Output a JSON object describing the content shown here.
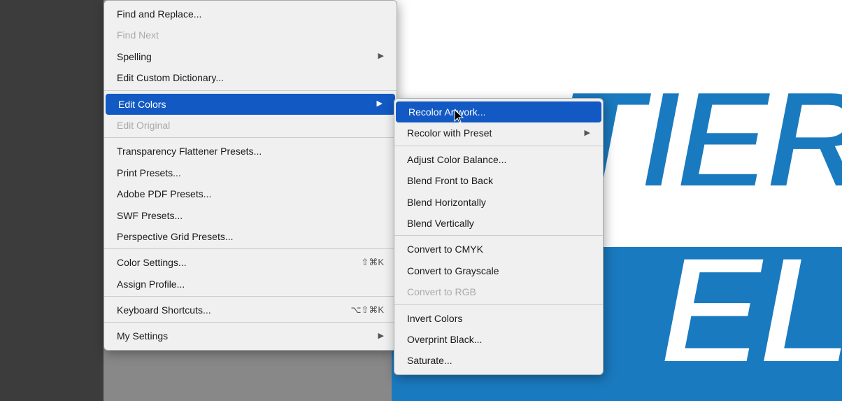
{
  "background": {
    "color": "#888888"
  },
  "canvas": {
    "text_tier": "TIER",
    "text_el": "EL",
    "blue_color": "#1a7abf"
  },
  "primary_menu": {
    "items": [
      {
        "id": "find-replace",
        "label": "Find and Replace...",
        "shortcut": "",
        "arrow": false,
        "disabled": false,
        "active": false,
        "separator_above": false,
        "separator_below": false
      },
      {
        "id": "find-next",
        "label": "Find Next",
        "shortcut": "",
        "arrow": false,
        "disabled": true,
        "active": false,
        "separator_above": false,
        "separator_below": false
      },
      {
        "id": "spelling",
        "label": "Spelling",
        "shortcut": "",
        "arrow": true,
        "disabled": false,
        "active": false,
        "separator_above": false,
        "separator_below": false
      },
      {
        "id": "edit-custom-dictionary",
        "label": "Edit Custom Dictionary...",
        "shortcut": "",
        "arrow": false,
        "disabled": false,
        "active": false,
        "separator_above": false,
        "separator_below": true
      },
      {
        "id": "edit-colors",
        "label": "Edit Colors",
        "shortcut": "",
        "arrow": true,
        "disabled": false,
        "active": true,
        "separator_above": false,
        "separator_below": false
      },
      {
        "id": "edit-original",
        "label": "Edit Original",
        "shortcut": "",
        "arrow": false,
        "disabled": true,
        "active": false,
        "separator_above": false,
        "separator_below": true
      },
      {
        "id": "transparency-flattener",
        "label": "Transparency Flattener Presets...",
        "shortcut": "",
        "arrow": false,
        "disabled": false,
        "active": false,
        "separator_above": false,
        "separator_below": false
      },
      {
        "id": "print-presets",
        "label": "Print Presets...",
        "shortcut": "",
        "arrow": false,
        "disabled": false,
        "active": false,
        "separator_above": false,
        "separator_below": false
      },
      {
        "id": "adobe-pdf-presets",
        "label": "Adobe PDF Presets...",
        "shortcut": "",
        "arrow": false,
        "disabled": false,
        "active": false,
        "separator_above": false,
        "separator_below": false
      },
      {
        "id": "swf-presets",
        "label": "SWF Presets...",
        "shortcut": "",
        "arrow": false,
        "disabled": false,
        "active": false,
        "separator_above": false,
        "separator_below": false
      },
      {
        "id": "perspective-grid-presets",
        "label": "Perspective Grid Presets...",
        "shortcut": "",
        "arrow": false,
        "disabled": false,
        "active": false,
        "separator_above": false,
        "separator_below": true
      },
      {
        "id": "color-settings",
        "label": "Color Settings...",
        "shortcut": "⇧⌘K",
        "arrow": false,
        "disabled": false,
        "active": false,
        "separator_above": false,
        "separator_below": false
      },
      {
        "id": "assign-profile",
        "label": "Assign Profile...",
        "shortcut": "",
        "arrow": false,
        "disabled": false,
        "active": false,
        "separator_above": false,
        "separator_below": true
      },
      {
        "id": "keyboard-shortcuts",
        "label": "Keyboard Shortcuts...",
        "shortcut": "⌥⇧⌘K",
        "arrow": false,
        "disabled": false,
        "active": false,
        "separator_above": false,
        "separator_below": true
      },
      {
        "id": "my-settings",
        "label": "My Settings",
        "shortcut": "",
        "arrow": true,
        "disabled": false,
        "active": false,
        "separator_above": false,
        "separator_below": false
      }
    ]
  },
  "secondary_menu": {
    "items": [
      {
        "id": "recolor-artwork",
        "label": "Recolor Artwork...",
        "shortcut": "",
        "arrow": false,
        "disabled": false,
        "active": true
      },
      {
        "id": "recolor-with-preset",
        "label": "Recolor with Preset",
        "shortcut": "",
        "arrow": true,
        "disabled": false,
        "active": false
      },
      {
        "id": "adjust-color-balance",
        "label": "Adjust Color Balance...",
        "shortcut": "",
        "arrow": false,
        "disabled": false,
        "active": false
      },
      {
        "id": "blend-front-to-back",
        "label": "Blend Front to Back",
        "shortcut": "",
        "arrow": false,
        "disabled": false,
        "active": false
      },
      {
        "id": "blend-horizontally",
        "label": "Blend Horizontally",
        "shortcut": "",
        "arrow": false,
        "disabled": false,
        "active": false
      },
      {
        "id": "blend-vertically",
        "label": "Blend Vertically",
        "shortcut": "",
        "arrow": false,
        "disabled": false,
        "active": false
      },
      {
        "id": "convert-to-cmyk",
        "label": "Convert to CMYK",
        "shortcut": "",
        "arrow": false,
        "disabled": false,
        "active": false
      },
      {
        "id": "convert-to-grayscale",
        "label": "Convert to Grayscale",
        "shortcut": "",
        "arrow": false,
        "disabled": false,
        "active": false
      },
      {
        "id": "convert-to-rgb",
        "label": "Convert to RGB",
        "shortcut": "",
        "arrow": false,
        "disabled": true,
        "active": false
      },
      {
        "id": "invert-colors",
        "label": "Invert Colors",
        "shortcut": "",
        "arrow": false,
        "disabled": false,
        "active": false
      },
      {
        "id": "overprint-black",
        "label": "Overprint Black...",
        "shortcut": "",
        "arrow": false,
        "disabled": false,
        "active": false
      },
      {
        "id": "saturate",
        "label": "Saturate...",
        "shortcut": "",
        "arrow": false,
        "disabled": false,
        "active": false
      }
    ]
  }
}
